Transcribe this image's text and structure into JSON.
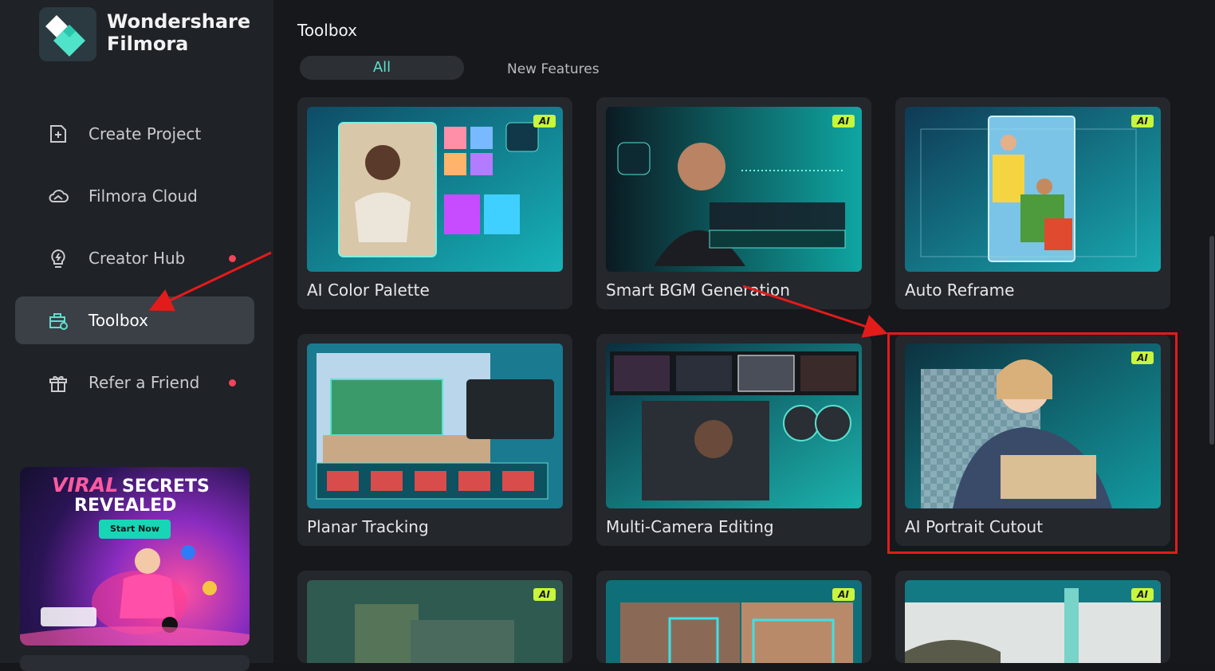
{
  "app": {
    "brand_line1": "Wondershare",
    "brand_line2": "Filmora"
  },
  "sidebar": {
    "items": [
      {
        "label": "Create Project",
        "icon": "plus-square-icon",
        "dot": false,
        "active": false
      },
      {
        "label": "Filmora Cloud",
        "icon": "cloud-icon",
        "dot": false,
        "active": false
      },
      {
        "label": "Creator Hub",
        "icon": "lightbulb-icon",
        "dot": true,
        "active": false
      },
      {
        "label": "Toolbox",
        "icon": "toolbox-icon",
        "dot": false,
        "active": true
      },
      {
        "label": "Refer a Friend",
        "icon": "gift-icon",
        "dot": true,
        "active": false
      }
    ],
    "promo": {
      "title_a": "VIRAL",
      "title_b": "SECRETS",
      "title_c": "REVEALED",
      "button": "Start Now"
    }
  },
  "main": {
    "title": "Toolbox",
    "tabs": [
      {
        "label": "All",
        "selected": true
      },
      {
        "label": "New Features",
        "selected": false
      }
    ],
    "ai_badge": "AI",
    "cards": [
      {
        "label": "AI Color Palette",
        "ai": true
      },
      {
        "label": "Smart BGM Generation",
        "ai": true
      },
      {
        "label": "Auto Reframe",
        "ai": true
      },
      {
        "label": "Planar Tracking",
        "ai": false
      },
      {
        "label": "Multi-Camera Editing",
        "ai": false
      },
      {
        "label": "AI Portrait Cutout",
        "ai": true
      },
      {
        "label": "",
        "ai": true
      },
      {
        "label": "",
        "ai": true
      },
      {
        "label": "",
        "ai": true
      }
    ]
  },
  "colors": {
    "accent": "#5ce0cd",
    "annotation_red": "#e31b1b",
    "ai_badge": "#c8f53d",
    "notification_dot": "#f0455a"
  }
}
